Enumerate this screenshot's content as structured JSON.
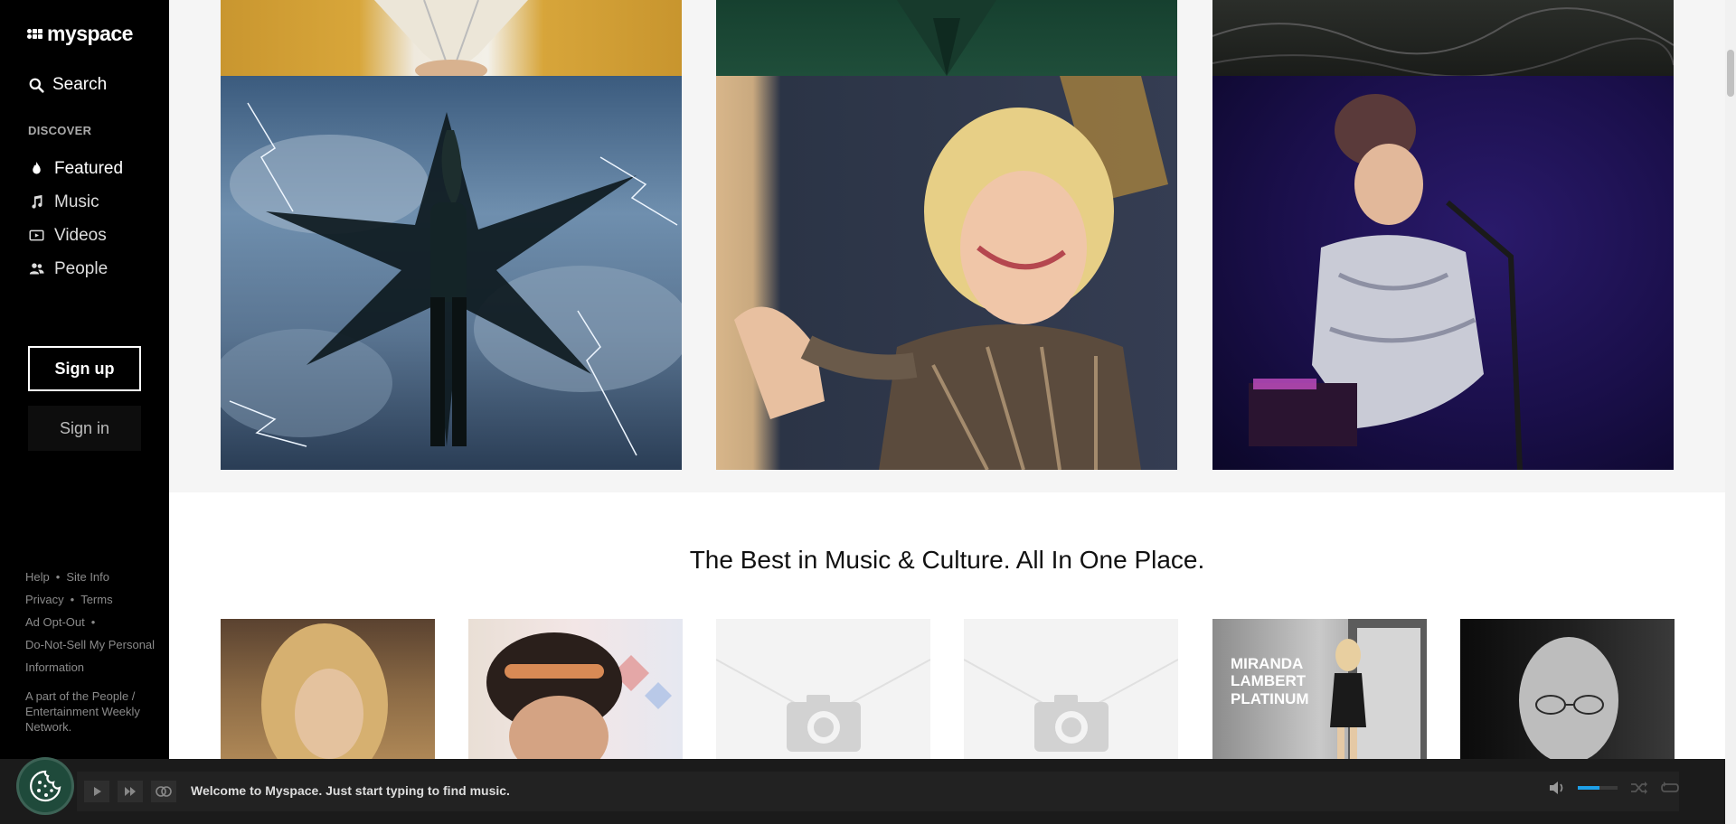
{
  "sidebar": {
    "logo_text": "myspace",
    "search_label": "Search",
    "discover_label": "DISCOVER",
    "nav": [
      {
        "label": "Featured",
        "icon": "flame-icon",
        "active": true
      },
      {
        "label": "Music",
        "icon": "music-note-icon",
        "active": false
      },
      {
        "label": "Videos",
        "icon": "video-icon",
        "active": false
      },
      {
        "label": "People",
        "icon": "people-icon",
        "active": false
      }
    ],
    "signup_label": "Sign up",
    "signin_label": "Sign in",
    "footer": {
      "help": "Help",
      "site_info": "Site Info",
      "privacy": "Privacy",
      "terms": "Terms",
      "ad_opt_out": "Ad Opt-Out",
      "dnsmpi": "Do-Not-Sell My Personal Information",
      "network_note": "A part of the People / Entertainment Weekly Network."
    }
  },
  "main": {
    "section_title": "The Best in Music & Culture. All In One Place.",
    "thumbnails": [
      {
        "kind": "photo",
        "name": "artist-photo-blonde-singer"
      },
      {
        "kind": "photo",
        "name": "artist-photo-headband-woman"
      },
      {
        "kind": "placeholder",
        "name": "camera-placeholder"
      },
      {
        "kind": "placeholder",
        "name": "camera-placeholder"
      },
      {
        "kind": "album",
        "name": "album-cover-platinum",
        "cover_text": [
          "MIRANDA",
          "LAMBERT",
          "PLATINUM"
        ]
      },
      {
        "kind": "photo",
        "name": "artist-photo-bw-man-glasses"
      }
    ]
  },
  "player": {
    "welcome_text": "Welcome to Myspace. Just start typing to find music.",
    "volume_level": 0.55
  },
  "colors": {
    "sidebar_bg": "#000000",
    "player_bg": "#1b1b1b",
    "accent_blue": "#1ea0e8",
    "cookie_green": "#1f4a3b"
  }
}
